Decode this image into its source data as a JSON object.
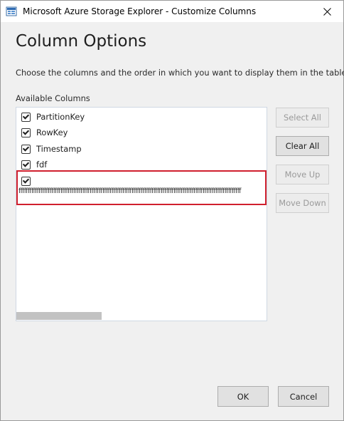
{
  "window": {
    "title": "Microsoft Azure Storage Explorer - Customize Columns",
    "close_symbol": "✕"
  },
  "dialog": {
    "heading": "Column Options",
    "description": "Choose the columns and the order in which you want to display them in the table.",
    "list_label": "Available Columns"
  },
  "columns": [
    {
      "label": "PartitionKey",
      "checked": true
    },
    {
      "label": "RowKey",
      "checked": true
    },
    {
      "label": "Timestamp",
      "checked": true
    },
    {
      "label": "fdf",
      "checked": true
    },
    {
      "label": "ffffffffffffffffffffffffffffffffffffffffffffffffffffffffffffffffffffffffffffffffffffffffffffffffffffffffffffffffffffffffff",
      "checked": true
    }
  ],
  "buttons": {
    "select_all": "Select All",
    "clear_all": "Clear All",
    "move_up": "Move Up",
    "move_down": "Move Down",
    "ok": "OK",
    "cancel": "Cancel"
  },
  "colors": {
    "highlight": "#d0202e",
    "list_border": "#cfd8e3",
    "title_bg": "#ffffff"
  },
  "icons": {
    "app": "azure-storage-explorer-icon",
    "close": "close-icon",
    "checkbox": "checkbox-checked-icon"
  }
}
